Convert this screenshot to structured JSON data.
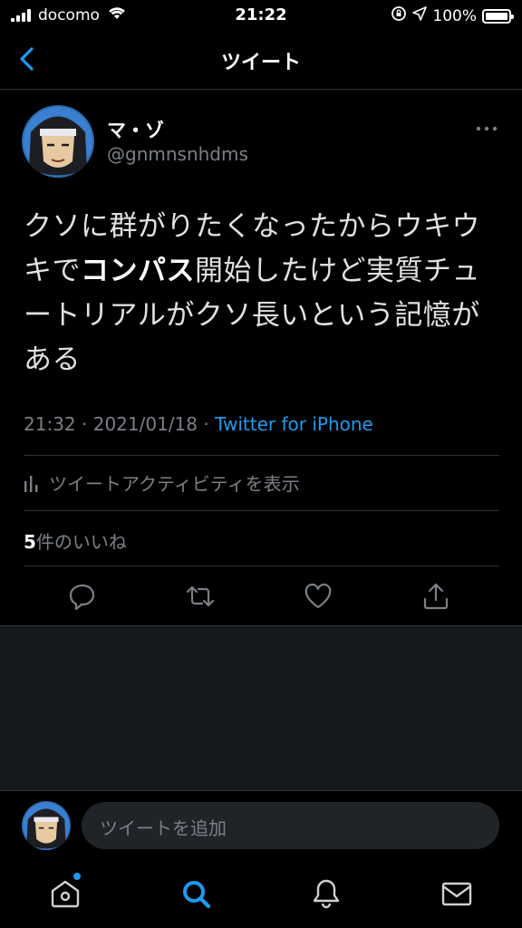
{
  "status_bar": {
    "carrier": "docomo",
    "time": "21:22",
    "battery": "100%"
  },
  "nav": {
    "title": "ツイート"
  },
  "tweet": {
    "user_name": "マ・ゾ",
    "user_handle": "@gnmnsnhdms",
    "text_before": "クソに群がりたくなったからウキウキで",
    "text_bold": "コンパス",
    "text_after": "開始したけど実質チュートリアルがクソ長いという記憶がある",
    "time": "21:32",
    "date": "2021/01/18",
    "separator": "·",
    "source": "Twitter for iPhone",
    "activity_label": "ツイートアクティビティを表示",
    "likes_count": "5",
    "likes_label": "件のいいね"
  },
  "reply": {
    "placeholder": "ツイートを追加"
  },
  "colors": {
    "accent": "#1d9bf0",
    "background": "#000000",
    "secondary_text": "#7b8087"
  }
}
